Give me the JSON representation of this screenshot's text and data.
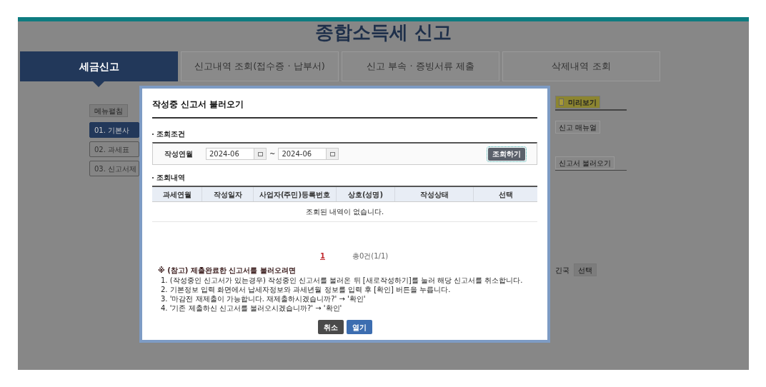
{
  "page_title": "종합소득세 신고",
  "tabs": [
    {
      "label": "세금신고",
      "selected": true
    },
    {
      "label": "신고내역 조회(접수증 · 납부서)",
      "selected": false
    },
    {
      "label": "신고 부속 · 증빙서류 제출",
      "selected": false
    },
    {
      "label": "삭제내역 조회",
      "selected": false
    }
  ],
  "side_menu": {
    "toggle": "메뉴펼침",
    "items": [
      {
        "label": "01. 기본사",
        "selected": true
      },
      {
        "label": "02. 과세표",
        "selected": false
      },
      {
        "label": "03. 신고서제",
        "selected": false
      }
    ]
  },
  "right_panel": {
    "preview_button": "미리보기",
    "manual_button": "신고 매뉴얼",
    "load_button": "신고서 불러오기",
    "country_label": "긴국",
    "select_button": "선택"
  },
  "dialog": {
    "title": "작성중 신고서 불러오기",
    "search_section": {
      "heading": "조회조건",
      "label": "작성연월",
      "from": "2024-06",
      "separator": "~",
      "to": "2024-06",
      "search_button": "조회하기"
    },
    "results_section": {
      "heading": "조회내역",
      "columns": [
        "과세연월",
        "작성일자",
        "사업자(주민)등록번호",
        "상호(성명)",
        "작성상태",
        "선택"
      ],
      "empty_message": "조회된 내역이 없습니다."
    },
    "pagination": {
      "pages": [
        {
          "label": "1",
          "selected": true
        }
      ],
      "total": "총0건(1/1)"
    },
    "note": {
      "heading": "※ (참고) 제출완료한 신고서를 불러오려면",
      "items": [
        "1. (작성중인 신고서가 있는경우) 작성중인 신고서를 불러온 뒤 [새로작성하기]를 눌러 해당 신고서를 취소합니다.",
        "2. 기본정보 입력 화면에서 납세자정보와 과세년월 정보를 입력 후 [확인] 버튼을 누릅니다.",
        "3. '마감전 재제출이 가능합니다. 재제출하시겠습니까?' → '확인'",
        "4. '기존 제출하신 신고서를 불러오시겠습니까?' → '확인'"
      ]
    },
    "buttons": [
      {
        "label": "취소",
        "kind": "secondary"
      },
      {
        "label": "열기",
        "kind": "primary"
      }
    ]
  }
}
